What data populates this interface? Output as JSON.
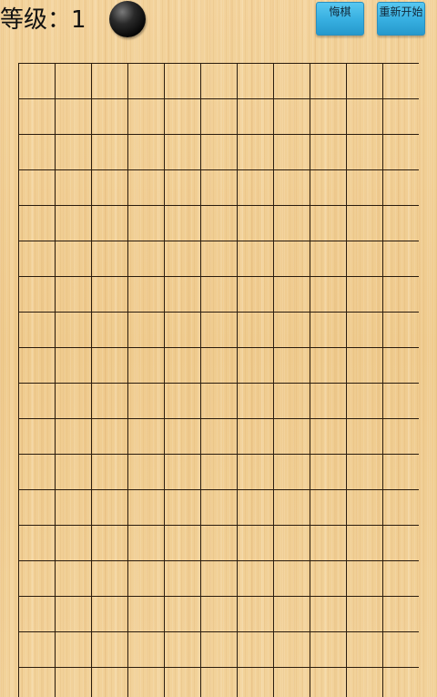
{
  "header": {
    "level_label": "等级：",
    "level_value": "1",
    "current_stone": "black"
  },
  "toolbar": {
    "undo_label": "悔棋",
    "restart_label": "重新开始"
  },
  "board": {
    "columns": 11,
    "rows": 18,
    "line_color": "#2a1c0e",
    "wood_color": "#f0cf96"
  },
  "colors": {
    "button_accent": "#36aee0",
    "stone_black": "#050505"
  }
}
